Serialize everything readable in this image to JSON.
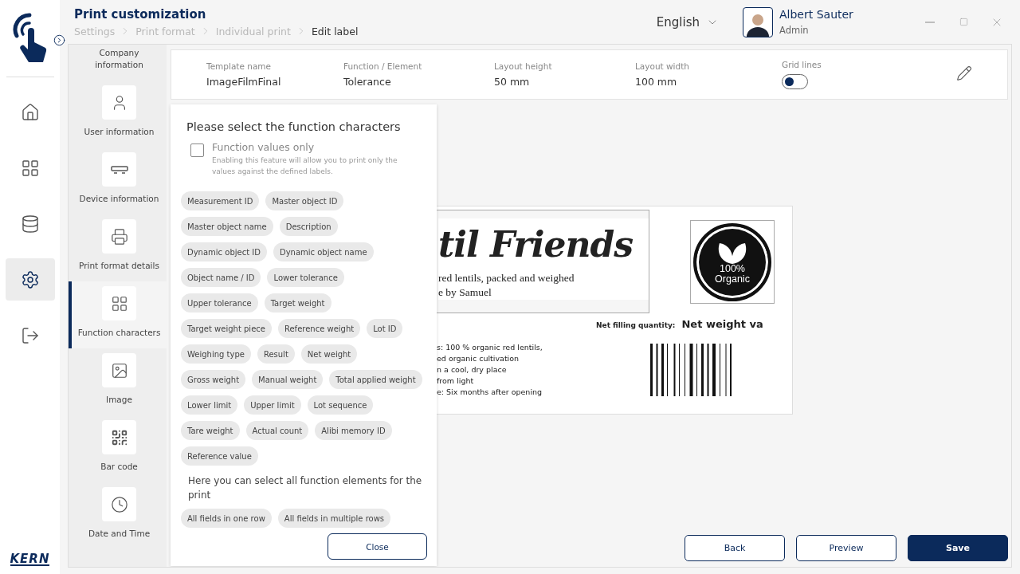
{
  "header": {
    "title": "Print customization",
    "breadcrumb": [
      {
        "label": "Settings",
        "current": false
      },
      {
        "label": "Print format",
        "current": false
      },
      {
        "label": "Individual print",
        "current": false
      },
      {
        "label": "Edit label",
        "current": true
      }
    ],
    "language": "English",
    "user": {
      "name": "Albert Sauter",
      "role": "Admin"
    }
  },
  "rail": [
    {
      "selected": false
    },
    {
      "selected": false
    },
    {
      "selected": false
    },
    {
      "selected": true
    },
    {
      "selected": false
    }
  ],
  "brand": "KERN",
  "elements": [
    {
      "label": "Company information",
      "selected": false
    },
    {
      "label": "User information",
      "selected": false
    },
    {
      "label": "Device information",
      "selected": false
    },
    {
      "label": "Print format details",
      "selected": false
    },
    {
      "label": "Function characters",
      "selected": true
    },
    {
      "label": "Image",
      "selected": false
    },
    {
      "label": "Bar code",
      "selected": false
    },
    {
      "label": "Date and Time",
      "selected": false
    }
  ],
  "info": {
    "fields": [
      {
        "label": "Template name",
        "value": "ImageFilmFinal"
      },
      {
        "label": "Function / Element",
        "value": "Tolerance"
      },
      {
        "label": "Layout height",
        "value": "50 mm"
      },
      {
        "label": "Layout width",
        "value": "100 mm"
      }
    ],
    "grid_lines": {
      "label": "Grid lines",
      "on": false
    }
  },
  "dialog": {
    "title": "Please select the function characters",
    "values_only": {
      "label": "Function values only",
      "hint": "Enabling this feature will allow you to print only the values against the defined labels.",
      "checked": false
    },
    "chips": [
      "Measurement ID",
      "Master object ID",
      "Master object name",
      "Description",
      "Dynamic object ID",
      "Dynamic object name",
      "Object name / ID",
      "Lower tolerance",
      "Upper tolerance",
      "Target weight",
      "Target weight piece",
      "Reference weight",
      "Lot ID",
      "Weighing type",
      "Result",
      "Net weight",
      "Gross weight",
      "Manual weight",
      "Total applied weight",
      "Lower limit",
      "Upper limit",
      "Lot sequence",
      "Tare weight",
      "Actual count",
      "Alibi memory ID",
      "Reference value"
    ],
    "section_text": "Here you can select all function elements for the print",
    "layout_chips": [
      "All fields in one row",
      "All fields in multiple rows"
    ],
    "close": "Close"
  },
  "label_preview": {
    "heading": "til Friends",
    "subtitle": [
      "red lentils, packed and weighed",
      "e by Samuel"
    ],
    "badge": [
      "100%",
      "Organic"
    ],
    "net_label": "Net filling quantity:",
    "net_value": "Net weight va",
    "details": [
      "s:  100 % organic red lentils,",
      "ed organic cultivation",
      "n a cool, dry place",
      "from light",
      "e:  Six months after opening"
    ]
  },
  "actions": [
    {
      "label": "Back",
      "kind": "secondary"
    },
    {
      "label": "Preview",
      "kind": "secondary"
    },
    {
      "label": "Save",
      "kind": "primary"
    }
  ]
}
